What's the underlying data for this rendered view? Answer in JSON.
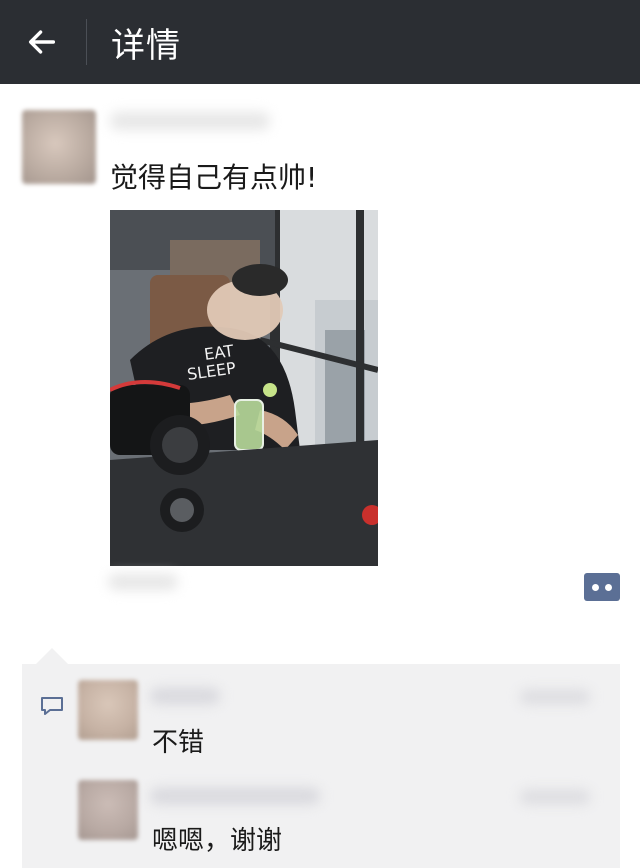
{
  "header": {
    "title": "详情",
    "back_icon": "arrow-left-icon",
    "bg_color": "#2b2e33"
  },
  "post": {
    "text": "觉得自己有点帅!",
    "more_icon": "more-dots-icon"
  },
  "comments": [
    {
      "text": "不错"
    },
    {
      "text": "嗯嗯，谢谢"
    }
  ],
  "colors": {
    "accent_blue": "#5b6f95",
    "comment_bg": "#f1f1f2"
  }
}
